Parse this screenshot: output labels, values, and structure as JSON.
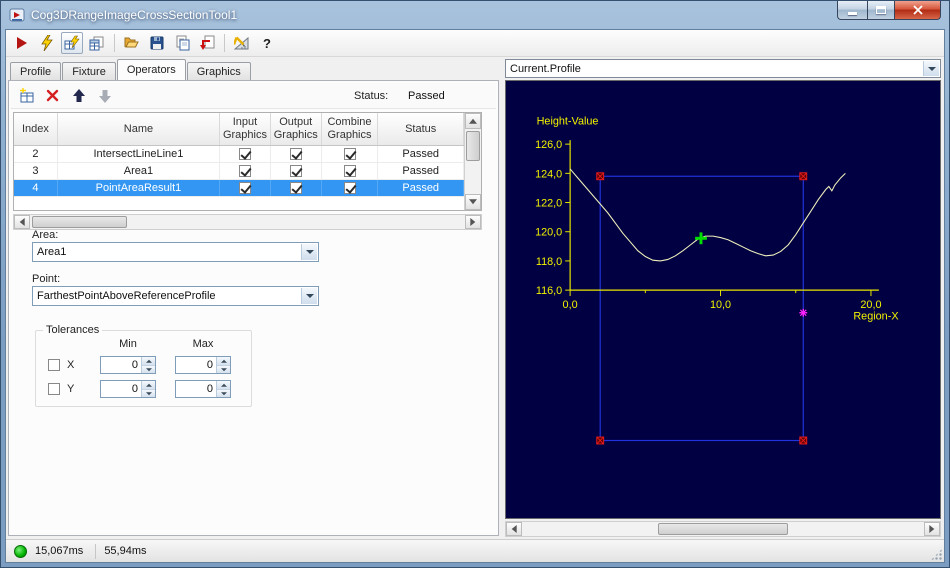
{
  "window": {
    "title": "Cog3DRangeImageCrossSectionTool1"
  },
  "main_toolbar": {
    "icons": [
      "run",
      "interactive-run",
      "electric-run",
      "results-grid",
      "open",
      "save",
      "paste-results",
      "import",
      "setup",
      "help"
    ],
    "help_glyph": "?"
  },
  "tabs": [
    {
      "label": "Profile",
      "active": false
    },
    {
      "label": "Fixture",
      "active": false
    },
    {
      "label": "Operators",
      "active": true
    },
    {
      "label": "Graphics",
      "active": false
    }
  ],
  "operators": {
    "status_label": "Status:",
    "status_value": "Passed",
    "grid": {
      "columns": [
        "Index",
        "Name",
        "Input Graphics",
        "Output Graphics",
        "Combine Graphics",
        "Status"
      ],
      "rows": [
        {
          "index": "2",
          "name": "IntersectLineLine1",
          "input_graphics": true,
          "output_graphics": true,
          "combine_graphics": true,
          "status": "Passed",
          "selected": false
        },
        {
          "index": "3",
          "name": "Area1",
          "input_graphics": true,
          "output_graphics": true,
          "combine_graphics": true,
          "status": "Passed",
          "selected": false
        },
        {
          "index": "4",
          "name": "PointAreaResult1",
          "input_graphics": true,
          "output_graphics": true,
          "combine_graphics": true,
          "status": "Passed",
          "selected": true
        }
      ]
    },
    "area": {
      "label": "Area:",
      "value": "Area1"
    },
    "point": {
      "label": "Point:",
      "value": "FarthestPointAboveReferenceProfile"
    },
    "tolerances": {
      "title": "Tolerances",
      "min_header": "Min",
      "max_header": "Max",
      "rows": [
        {
          "label": "X",
          "checked": false,
          "min": "0",
          "max": "0"
        },
        {
          "label": "Y",
          "checked": false,
          "min": "0",
          "max": "0"
        }
      ]
    }
  },
  "display": {
    "selector_value": "Current.Profile"
  },
  "chart_data": {
    "type": "line",
    "title": "Current.Profile",
    "xlabel": "Region-X",
    "ylabel": "Height-Value",
    "xlim": [
      0,
      20
    ],
    "ylim": [
      116,
      126
    ],
    "background": "#000042",
    "axis_color": "#e8e800",
    "label_color": "#f2f200",
    "y_ticks": [
      {
        "v": 116,
        "label": "116,0"
      },
      {
        "v": 118,
        "label": "118,0"
      },
      {
        "v": 120,
        "label": "120,0"
      },
      {
        "v": 122,
        "label": "122,0"
      },
      {
        "v": 124,
        "label": "124,0"
      },
      {
        "v": 126,
        "label": "126,0"
      }
    ],
    "x_ticks": [
      {
        "v": 0,
        "label": "0,0"
      },
      {
        "v": 10,
        "label": "10,0"
      },
      {
        "v": 20,
        "label": "20,0"
      }
    ],
    "x_minor_ticks": [
      5,
      15
    ],
    "series": [
      {
        "name": "profile",
        "color": "#eeeebb",
        "x": [
          0,
          0.5,
          1,
          1.5,
          2,
          2.5,
          3,
          3.5,
          4,
          4.5,
          5,
          5.5,
          6,
          6.5,
          7,
          7.5,
          8,
          8.5,
          9,
          9.5,
          10,
          10.5,
          11,
          11.5,
          12,
          12.5,
          13,
          13.5,
          14,
          14.5,
          15,
          15.5,
          16,
          16.5,
          17,
          17.2,
          17.4,
          17.6,
          18,
          18.3
        ],
        "y": [
          124.3,
          123.7,
          123.1,
          122.5,
          121.9,
          121.3,
          120.6,
          119.9,
          119.3,
          118.7,
          118.3,
          118.05,
          118.0,
          118.1,
          118.35,
          118.7,
          119.1,
          119.5,
          119.7,
          119.7,
          119.6,
          119.45,
          119.2,
          118.95,
          118.7,
          118.5,
          118.35,
          118.4,
          118.65,
          119.1,
          119.8,
          120.6,
          121.4,
          122.2,
          122.9,
          123.1,
          122.8,
          123.2,
          123.7,
          124.0
        ]
      }
    ],
    "region": {
      "x0": 2.0,
      "x1": 15.5,
      "y_top": 123.8,
      "y_bottom": 105.7,
      "color": "#2233dd",
      "handle_fill": "#5c0000",
      "handle_stroke": "#e81c1c"
    },
    "markers": [
      {
        "type": "cross",
        "x": 8.7,
        "y": 119.55,
        "color": "#00dd00"
      },
      {
        "type": "asterisk",
        "x": 15.5,
        "y": 114.45,
        "color": "#ff22ff"
      }
    ]
  },
  "status_bar": {
    "values": [
      "15,067ms",
      "55,94ms"
    ]
  }
}
